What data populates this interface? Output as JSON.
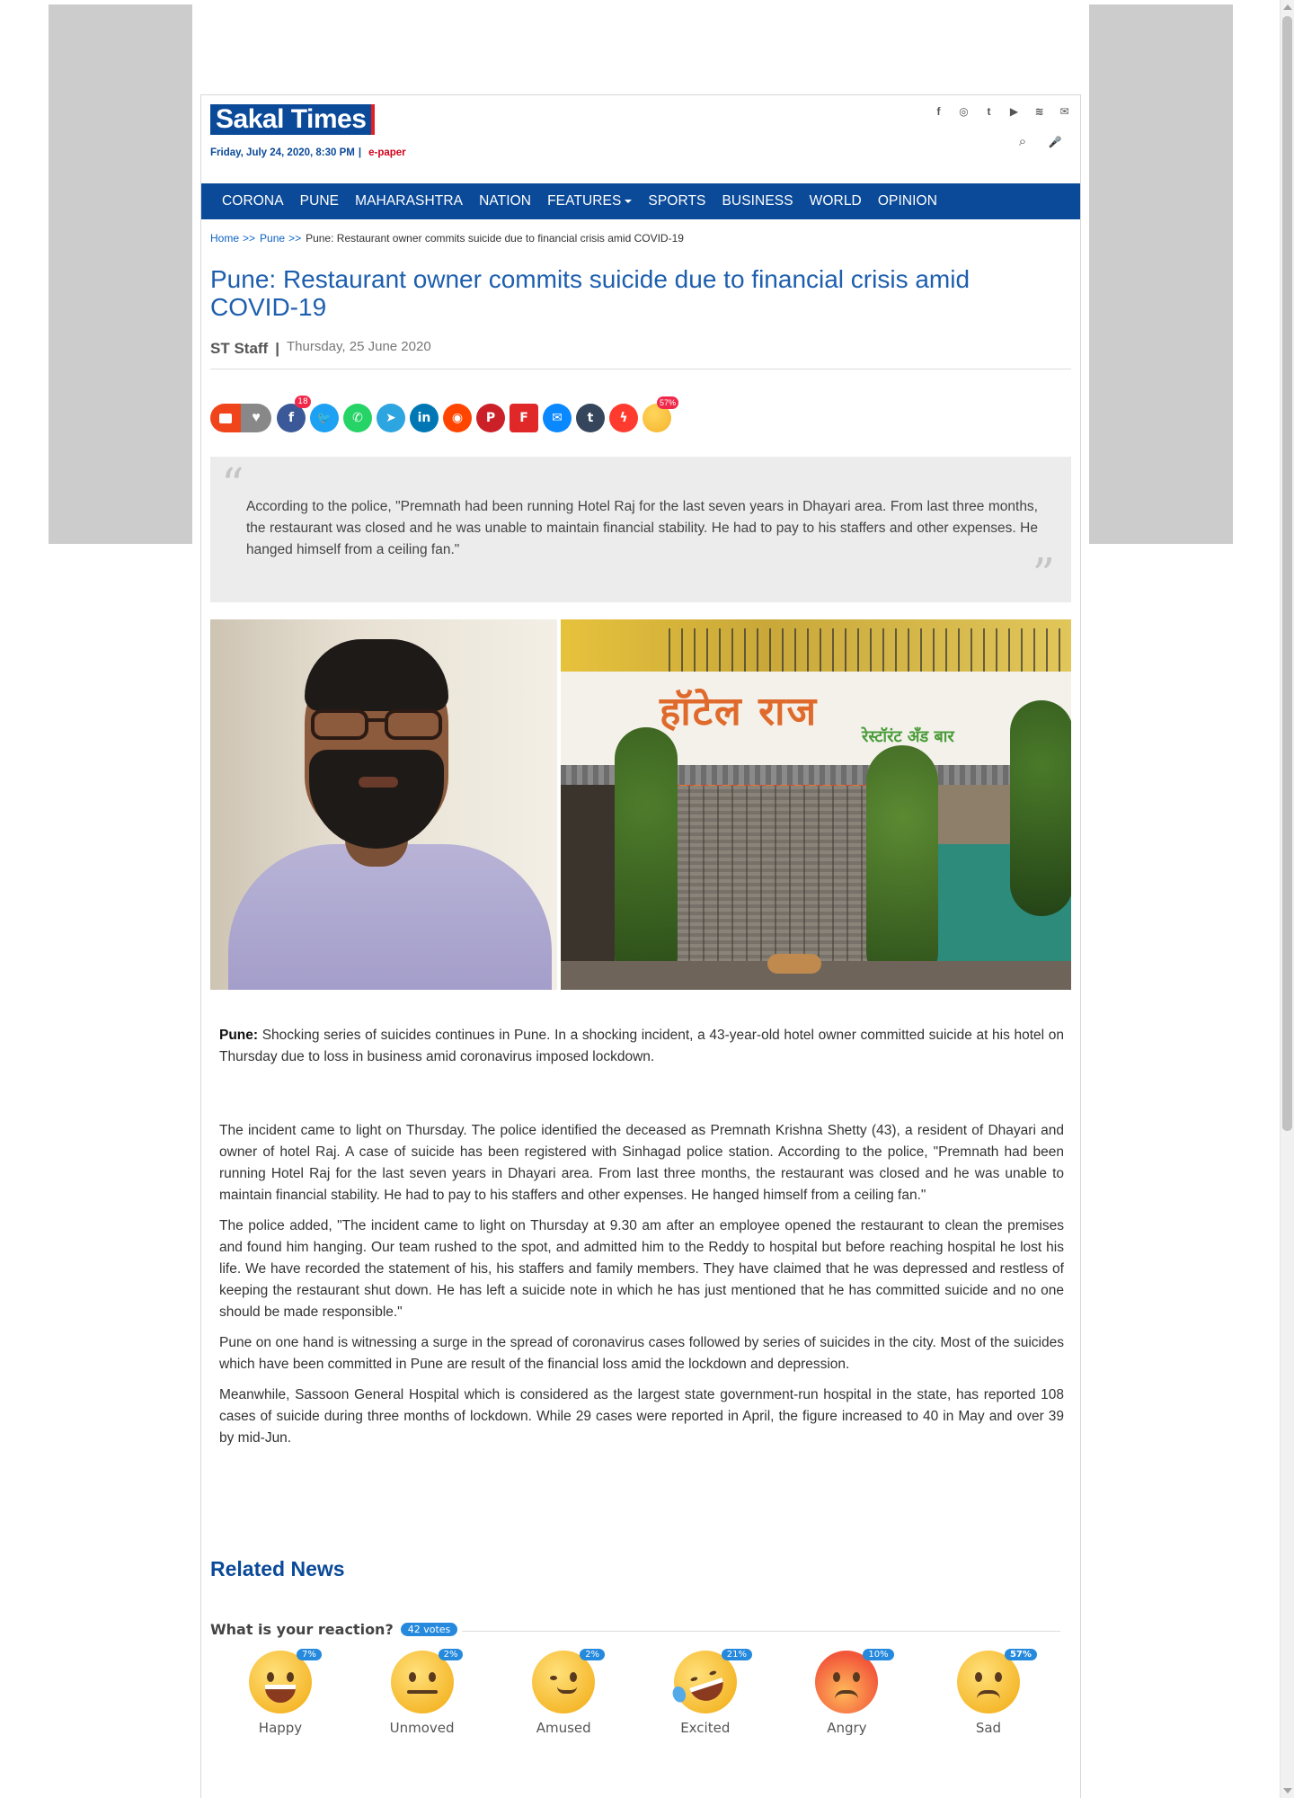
{
  "site": {
    "logo_text": "Sakal Times",
    "dateline": "Friday, July 24, 2020, 8:30 PM",
    "dateline_sep": "|",
    "epaper": "e-paper",
    "brand_color": "#0b4a99",
    "accent_color": "#e31e24"
  },
  "social_top": [
    {
      "name": "facebook-icon",
      "glyph": "f"
    },
    {
      "name": "instagram-icon",
      "glyph": "◎"
    },
    {
      "name": "tumblr-icon",
      "glyph": "t"
    },
    {
      "name": "youtube-icon",
      "glyph": "▶"
    },
    {
      "name": "rss-icon",
      "glyph": "≋"
    },
    {
      "name": "mail-icon",
      "glyph": "✉"
    }
  ],
  "util_icons": {
    "search": "⌕",
    "mic": "🎤"
  },
  "nav": {
    "items": [
      "CORONA",
      "PUNE",
      "MAHARASHTRA",
      "NATION",
      "FEATURES",
      "SPORTS",
      "BUSINESS",
      "WORLD",
      "OPINION"
    ]
  },
  "breadcrumb": {
    "home": "Home",
    "section": "Pune",
    "sep": ">>",
    "current": "Pune: Restaurant owner commits suicide due to financial crisis amid COVID-19"
  },
  "article": {
    "title": "Pune: Restaurant owner commits suicide due to financial crisis amid COVID-19",
    "author": "ST Staff",
    "byline_sep": "|",
    "date": "Thursday, 25 June 2020",
    "quote": "According to the police, \"Premnath had been running Hotel Raj for the last seven years in Dhayari area. From last three months, the restaurant was closed and he was unable to maintain financial stability. He had to pay to his staffers and other expenses. He hanged himself from a ceiling fan.\"",
    "quote_open": "“",
    "quote_close": "”",
    "image_sign_big": "हॉटेल राज",
    "image_sign_small": "रेस्टॉरंट अँड बार",
    "lead_label": "Pune:",
    "lead": " Shocking series of suicides continues in Pune. In a shocking incident, a 43-year-old hotel owner committed suicide at his hotel on Thursday due to loss in business amid coronavirus imposed lockdown.",
    "paragraphs": [
      "The incident came to light on Thursday. The police identified the deceased as Premnath Krishna Shetty (43), a resident of Dhayari and owner of hotel Raj. A case of suicide has been registered with Sinhagad police station. According to the police, \"Premnath had been running Hotel Raj for the last seven years in Dhayari area. From last three months, the restaurant was closed and he was unable to maintain financial stability. He had to pay to his staffers and other expenses. He hanged himself from a ceiling fan.\"",
      "The police added, \"The incident came to light on Thursday at 9.30 am after an employee opened the restaurant to clean the premises and found him hanging. Our team rushed to the spot, and admitted him to the Reddy to hospital but before reaching hospital he lost his life. We have recorded the statement of his, his staffers and family members. They have claimed that he was depressed and restless of keeping the restaurant shut down. He has left a suicide note in which he has just mentioned that he has committed suicide and no one should be made responsible.\"",
      "Pune on one hand is witnessing a surge in the spread of coronavirus cases followed by series of suicides in the city. Most of the suicides which have been committed in Pune are result of the financial loss amid the lockdown and depression.",
      "Meanwhile, Sassoon General Hospital which is considered as the largest state government-run hospital in the state, has reported 108 cases of suicide during three months of lockdown. While 29 cases were reported in April, the figure increased to 40 in May and over 39 by mid-Jun."
    ]
  },
  "share": {
    "facebook_count": "18",
    "reaction_badge": "57%",
    "icons": [
      {
        "name": "facebook-share-icon",
        "glyph": "f",
        "color": "#3b5998"
      },
      {
        "name": "twitter-share-icon",
        "glyph": "🐦",
        "color": "#1da1f2"
      },
      {
        "name": "whatsapp-share-icon",
        "glyph": "✆",
        "color": "#25d366"
      },
      {
        "name": "telegram-share-icon",
        "glyph": "➤",
        "color": "#2ca5e0"
      },
      {
        "name": "linkedin-share-icon",
        "glyph": "in",
        "color": "#0077b5"
      },
      {
        "name": "reddit-share-icon",
        "glyph": "◉",
        "color": "#ff4500"
      },
      {
        "name": "pinterest-share-icon",
        "glyph": "P",
        "color": "#cb2027"
      },
      {
        "name": "flipboard-share-icon",
        "glyph": "F",
        "color": "#e12828"
      },
      {
        "name": "email-share-icon",
        "glyph": "✉",
        "color": "#0a88ff"
      },
      {
        "name": "tumblr-share-icon",
        "glyph": "t",
        "color": "#35465c"
      },
      {
        "name": "messenger-share-icon",
        "glyph": "ϟ",
        "color": "#ff3b30"
      }
    ]
  },
  "related": {
    "title": "Related News"
  },
  "reactions": {
    "question": "What is your reaction?",
    "votes": "42 votes",
    "items": [
      {
        "label": "Happy",
        "pct": "7%"
      },
      {
        "label": "Unmoved",
        "pct": "2%"
      },
      {
        "label": "Amused",
        "pct": "2%"
      },
      {
        "label": "Excited",
        "pct": "21%"
      },
      {
        "label": "Angry",
        "pct": "10%"
      },
      {
        "label": "Sad",
        "pct": "57%"
      }
    ]
  }
}
